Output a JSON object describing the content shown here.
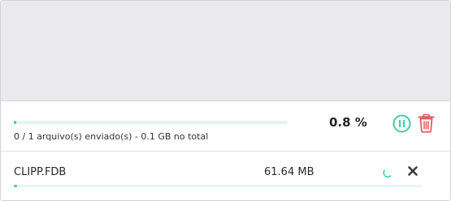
{
  "drop_area": {},
  "summary": {
    "progress_fraction": 0.008,
    "status_text": "0 / 1 arquivo(s) enviado(s) - 0.1 GB no total",
    "percent_text": "0.8 %",
    "pause_icon": "pause-icon",
    "delete_icon": "trash-icon"
  },
  "files": [
    {
      "name": "CLIPP.FDB",
      "size": "61.64 MB",
      "progress_fraction": 0.008,
      "status_icon": "spinner-icon",
      "cancel_icon": "close-icon"
    }
  ],
  "colors": {
    "accent": "#3ecfa8",
    "track": "#e3f5f0",
    "danger": "#e5535f",
    "cancel": "#3a4048",
    "drop_area_bg": "#e9e9ee"
  }
}
